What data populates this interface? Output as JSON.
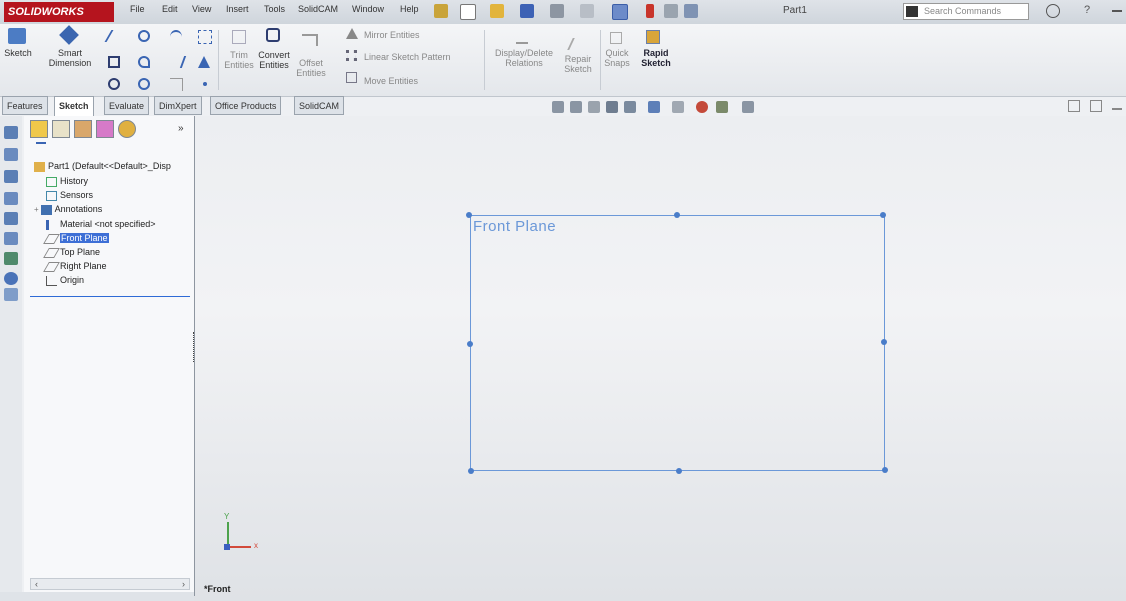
{
  "app": {
    "logo": "SOLIDWORKS",
    "doc_title": "Part1",
    "search_placeholder": "Search Commands",
    "menu": [
      "File",
      "Edit",
      "View",
      "Insert",
      "Tools",
      "SolidCAM",
      "Window",
      "Help"
    ]
  },
  "ribbon": {
    "sketch": "Sketch",
    "smart_dimension": [
      "Smart",
      "Dimension"
    ],
    "trim": [
      "Trim",
      "Entities"
    ],
    "convert": [
      "Convert",
      "Entities"
    ],
    "offset": [
      "Offset",
      "Entities"
    ],
    "mirror": "Mirror Entities",
    "linear_pattern": "Linear Sketch Pattern",
    "move": "Move Entities",
    "display_delete": [
      "Display/Delete",
      "Relations"
    ],
    "repair": [
      "Repair",
      "Sketch"
    ],
    "quick_snaps": [
      "Quick",
      "Snaps"
    ],
    "rapid_sketch": [
      "Rapid",
      "Sketch"
    ]
  },
  "tabs": [
    "Features",
    "Sketch",
    "Evaluate",
    "DimXpert",
    "Office Products",
    "SolidCAM"
  ],
  "active_tab": "Sketch",
  "tree": {
    "root": "Part1 (Default<<Default>_Disp",
    "items": [
      "History",
      "Sensors",
      "Annotations",
      "Material <not specified>",
      "Front Plane",
      "Top Plane",
      "Right Plane",
      "Origin"
    ],
    "selected": "Front Plane"
  },
  "canvas": {
    "plane_label": "Front Plane",
    "view_label": "*Front",
    "triad_x": "x",
    "triad_y": "Y"
  },
  "colors": {
    "plane": "#6b98d8",
    "selection": "#3d6fd6",
    "brand": "#b5141e"
  }
}
